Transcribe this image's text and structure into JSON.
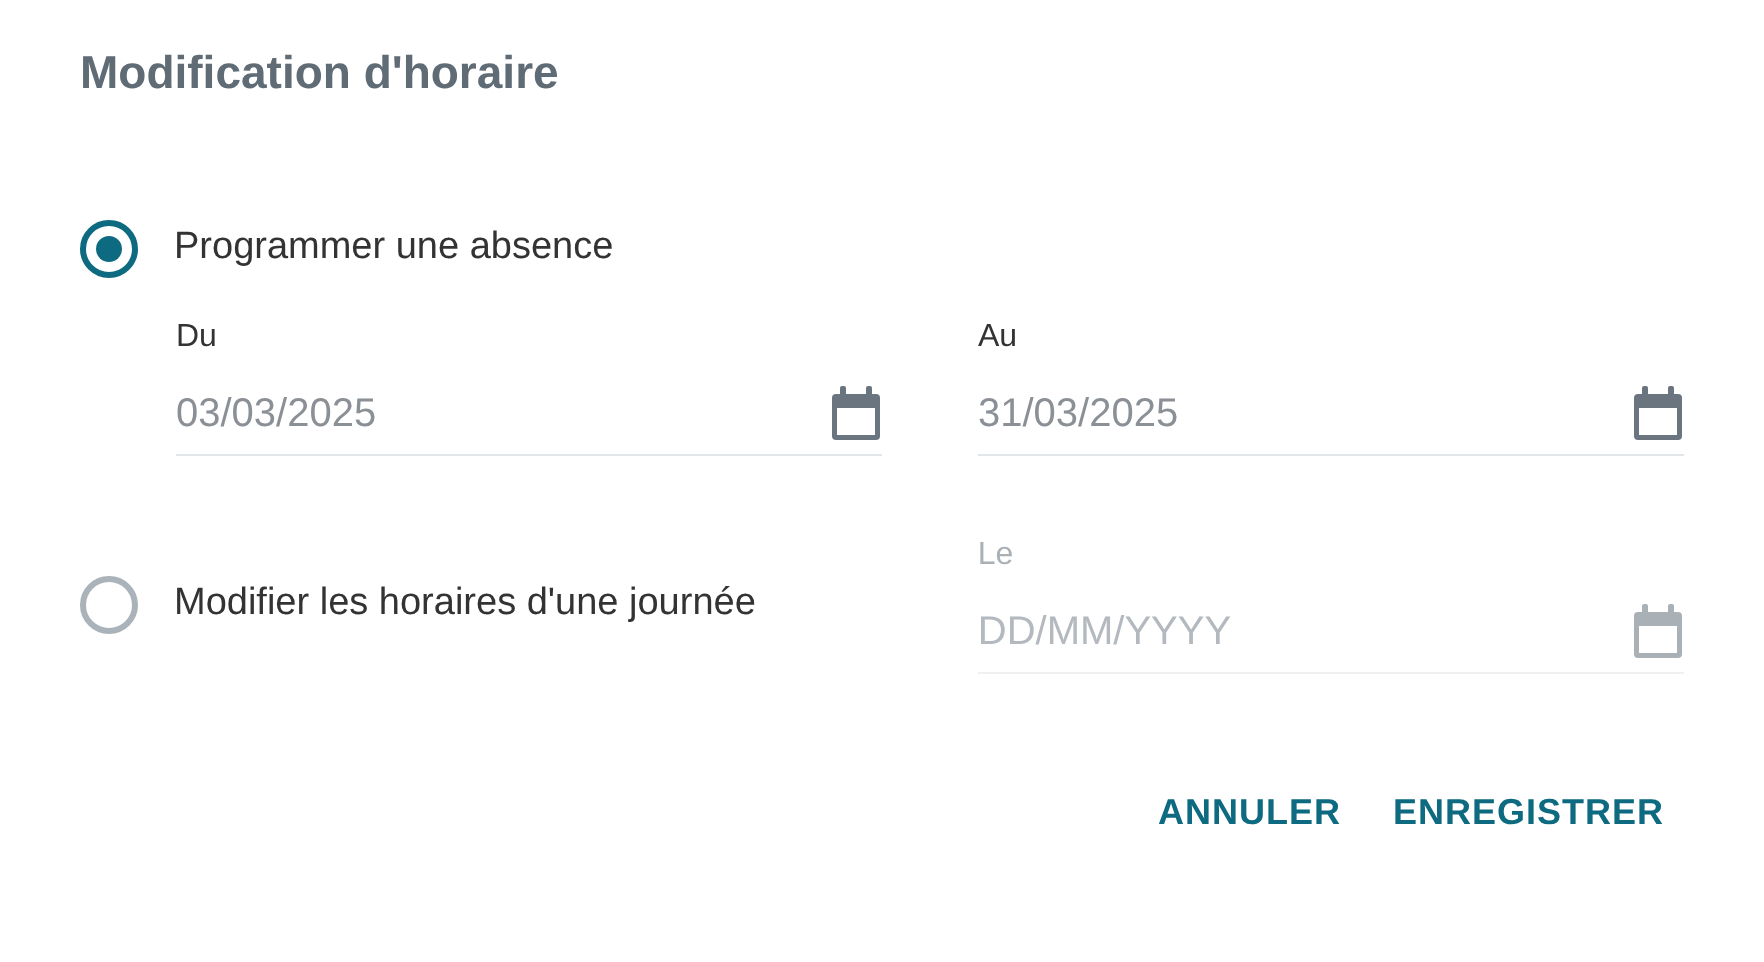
{
  "title": "Modification d'horaire",
  "options": [
    {
      "kind": "stacked",
      "label": "Programmer une absence",
      "selected": true,
      "fields": [
        {
          "label": "Du",
          "value": "03/03/2025",
          "disabled": false
        },
        {
          "label": "Au",
          "value": "31/03/2025",
          "disabled": false
        }
      ]
    },
    {
      "kind": "inline",
      "label": "Modifier les horaires d'une journée",
      "selected": false,
      "fields": [
        {
          "label": "Le",
          "placeholder": "DD/MM/YYYY",
          "disabled": true
        }
      ]
    }
  ],
  "buttons": [
    "ANNULER",
    "ENREGISTRER"
  ]
}
